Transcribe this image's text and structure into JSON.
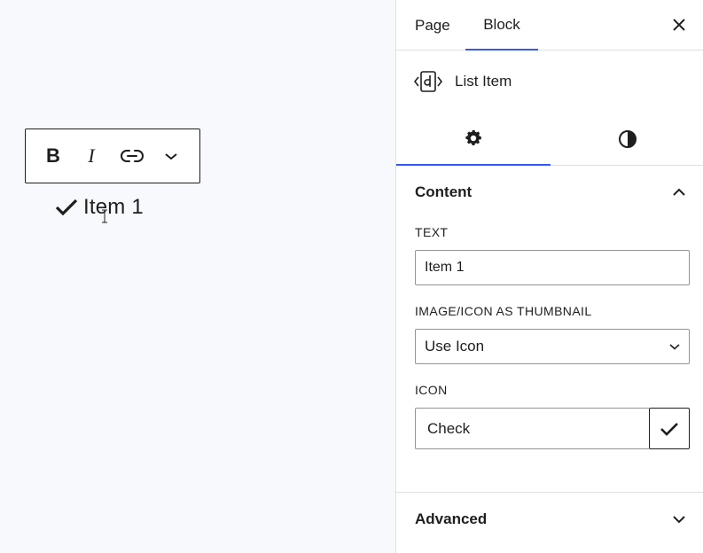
{
  "canvas": {
    "toolbar": {
      "bold_label": "B",
      "italic_label": "I",
      "link_icon": "link-icon",
      "more_icon": "chevron-down-icon"
    },
    "list_item": {
      "icon": "check-icon",
      "text": "Item 1"
    }
  },
  "sidebar": {
    "tabs": [
      {
        "label": "Page"
      },
      {
        "label": "Block"
      }
    ],
    "close_icon": "close-icon",
    "block_card": {
      "icon": "list-item-icon",
      "title": "List Item"
    },
    "inspector_tabs": [
      {
        "icon": "gear-icon"
      },
      {
        "icon": "contrast-icon"
      }
    ],
    "panel": {
      "title": "Content",
      "text_label": "TEXT",
      "text_value": "Item 1",
      "thumb_label": "IMAGE/ICON AS THUMBNAIL",
      "thumb_value": "Use Icon",
      "icon_label": "ICON",
      "icon_value": "Check"
    },
    "advanced_title": "Advanced"
  },
  "colors": {
    "accent": "#3858e9",
    "text": "#1e1e1e",
    "border": "#949494",
    "canvas_bg": "#f7f9fc"
  }
}
